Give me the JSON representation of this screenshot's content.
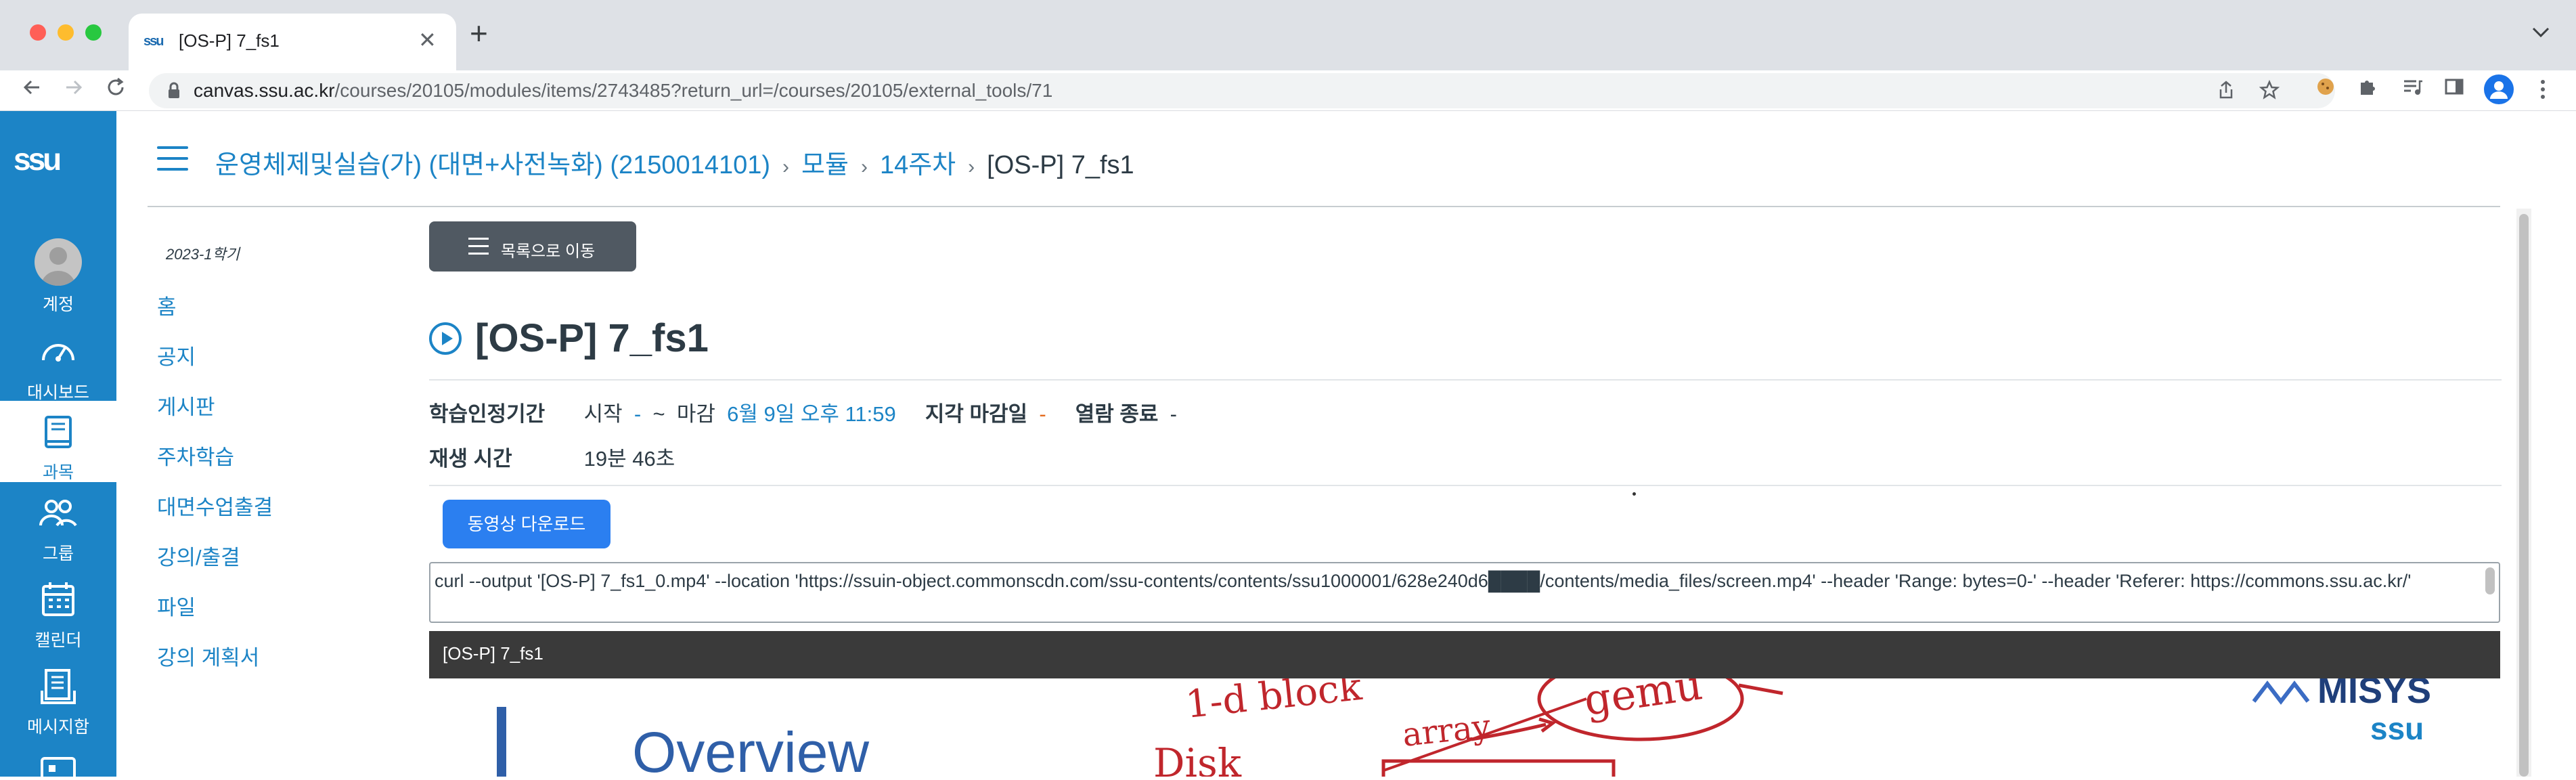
{
  "browser": {
    "tab_title": "[OS-P] 7_fs1",
    "tab_favicon_text": "ssu",
    "close_glyph": "✕",
    "new_tab_glyph": "+",
    "url_host": "canvas.ssu.ac.kr",
    "url_path": "/courses/20105/modules/items/2743485?return_url=/courses/20105/external_tools/71"
  },
  "global_nav": {
    "logo": "ssu",
    "items": [
      {
        "label": "계정",
        "icon": "avatar"
      },
      {
        "label": "대시보드",
        "icon": "dashboard-gauge-icon"
      },
      {
        "label": "과목",
        "icon": "book-icon",
        "active": true
      },
      {
        "label": "그룹",
        "icon": "people-icon"
      },
      {
        "label": "캘린더",
        "icon": "calendar-icon"
      },
      {
        "label": "메시지함",
        "icon": "inbox-icon"
      }
    ]
  },
  "breadcrumb": {
    "course": "운영체제및실습(가) (대면+사전녹화) (2150014101)",
    "modules": "모듈",
    "week": "14주차",
    "current": "[OS-P] 7_fs1"
  },
  "course_nav": {
    "term": "2023-1학기",
    "items": [
      "홈",
      "공지",
      "게시판",
      "주차학습",
      "대면수업출결",
      "강의/출결",
      "파일",
      "강의 계획서"
    ]
  },
  "content": {
    "list_button": "목록으로 이동",
    "title": "[OS-P] 7_fs1",
    "period_label": "학습인정기간",
    "start_label": "시작",
    "start_value": "-",
    "tilde": "~",
    "end_label": "마감",
    "end_value": "6월 9일 오후 11:59",
    "late_label": "지각 마감일",
    "late_value": "-",
    "close_label": "열람 종료",
    "close_value": "-",
    "duration_label": "재생 시간",
    "duration_value": "19분 46초",
    "download_button": "동영상 다운로드",
    "curl_command": "curl --output '[OS-P] 7_fs1_0.mp4' --location 'https://ssuin-object.commonscdn.com/ssu-contents/contents/ssu1000001/628e240d6████/contents/media_files/screen.mp4' --header 'Range: bytes=0-' --header 'Referer: https://commons.ssu.ac.kr/'",
    "video_title": "[OS-P] 7_fs1",
    "slide_heading": "Overview",
    "slide_logo": "MISYS",
    "slide_logo_sub": "ssu",
    "handwriting": [
      "1-d block",
      "array",
      "gemu",
      "Disk"
    ]
  },
  "colors": {
    "brand_blue": "#1c84c6",
    "button_dark": "#505962",
    "download_blue": "#2b7ff0",
    "late_orange": "#e46b1e",
    "ink_red": "#c0262c"
  }
}
